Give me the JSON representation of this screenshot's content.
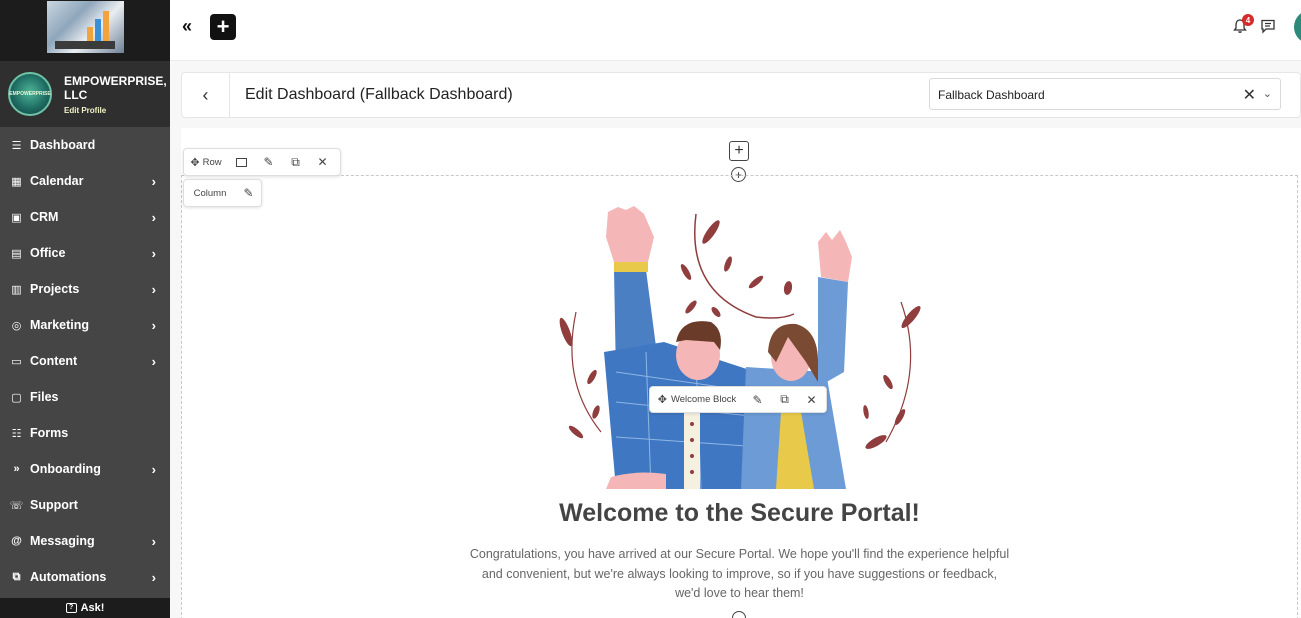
{
  "org": {
    "name": "EMPOWERPRISE, LLC",
    "edit_profile": "Edit Profile",
    "logo_text": "EMPOWERPRISE"
  },
  "sidebar": {
    "items": [
      {
        "label": "Dashboard",
        "icon": "menu-lines-icon",
        "has_submenu": false
      },
      {
        "label": "Calendar",
        "icon": "calendar-icon",
        "has_submenu": true
      },
      {
        "label": "CRM",
        "icon": "contacts-icon",
        "has_submenu": true
      },
      {
        "label": "Office",
        "icon": "office-icon",
        "has_submenu": true
      },
      {
        "label": "Projects",
        "icon": "kanban-icon",
        "has_submenu": true
      },
      {
        "label": "Marketing",
        "icon": "marketing-icon",
        "has_submenu": true
      },
      {
        "label": "Content",
        "icon": "content-icon",
        "has_submenu": true
      },
      {
        "label": "Files",
        "icon": "folder-icon",
        "has_submenu": false
      },
      {
        "label": "Forms",
        "icon": "form-list-icon",
        "has_submenu": false
      },
      {
        "label": "Onboarding",
        "icon": "double-chevron-icon",
        "has_submenu": true
      },
      {
        "label": "Support",
        "icon": "support-icon",
        "has_submenu": false
      },
      {
        "label": "Messaging",
        "icon": "at-sign-icon",
        "has_submenu": true
      },
      {
        "label": "Automations",
        "icon": "automation-icon",
        "has_submenu": true
      }
    ],
    "ask_label": "Ask!"
  },
  "topbar": {
    "notification_count": "4"
  },
  "header": {
    "title": "Edit Dashboard (Fallback Dashboard)",
    "selected_dashboard": "Fallback Dashboard"
  },
  "builder": {
    "row_label": "Row",
    "column_label": "Column",
    "welcome_block_label": "Welcome Block"
  },
  "welcome": {
    "title": "Welcome to the Secure Portal!",
    "text": "Congratulations, you have arrived at our Secure Portal. We hope you'll find the experience helpful and convenient, but we're always looking to improve, so if you have suggestions or feedback, we'd love to hear them!"
  },
  "colors": {
    "sidebar_bg": "#454545",
    "sidebar_dark": "#1c1c1c",
    "accent": "#2b8a7a",
    "badge": "#d62b2b"
  }
}
